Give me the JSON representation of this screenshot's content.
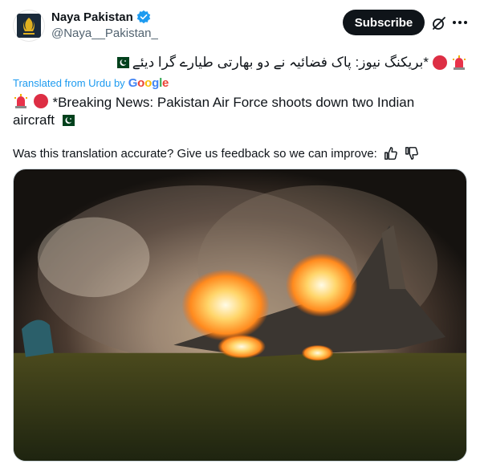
{
  "author": {
    "display_name": "Naya Pakistan",
    "handle": "@Naya__Pakistan_",
    "avatar_icon": "naya-pakistan-logo"
  },
  "actions": {
    "subscribe_label": "Subscribe",
    "grok_icon": "grok-icon",
    "more_icon": "more-icon"
  },
  "post": {
    "urdu_text": "*بریکنگ نیوز: پاک فضائیہ نے دو بھارتی طیارے گرا دیئے",
    "translated_from": "Translated from Urdu by",
    "google_word": "Google",
    "english_text": "*Breaking News: Pakistan Air Force shoots down two Indian aircraft"
  },
  "feedback": {
    "prompt": "Was this translation accurate? Give us feedback so we can improve:"
  },
  "colors": {
    "accent": "#1d9bf0",
    "text": "#0f1419",
    "secondary": "#536471",
    "button_bg": "#0f1419"
  }
}
